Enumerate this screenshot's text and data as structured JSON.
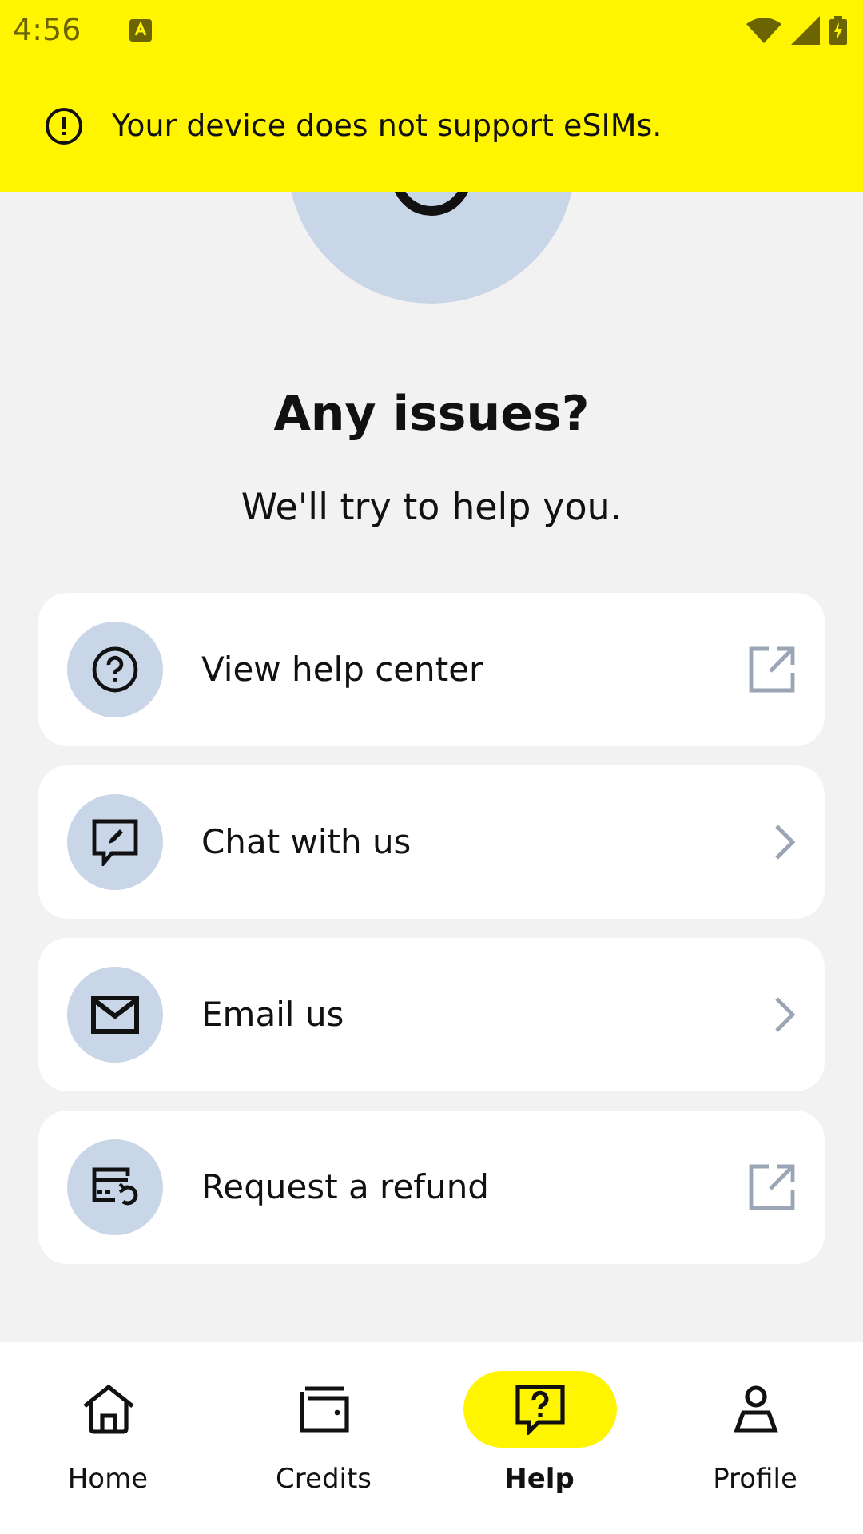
{
  "status_bar": {
    "time": "4:56"
  },
  "banner": {
    "message": "Your device does not support eSIMs."
  },
  "header": {
    "title": "Any issues?",
    "subtitle": "We'll try to help you."
  },
  "options": [
    {
      "label": "View help center",
      "kind": "external"
    },
    {
      "label": "Chat with us",
      "kind": "navigate"
    },
    {
      "label": "Email us",
      "kind": "navigate"
    },
    {
      "label": "Request a refund",
      "kind": "external"
    }
  ],
  "nav": [
    {
      "label": "Home",
      "selected": false
    },
    {
      "label": "Credits",
      "selected": false
    },
    {
      "label": "Help",
      "selected": true
    },
    {
      "label": "Profile",
      "selected": false
    }
  ]
}
